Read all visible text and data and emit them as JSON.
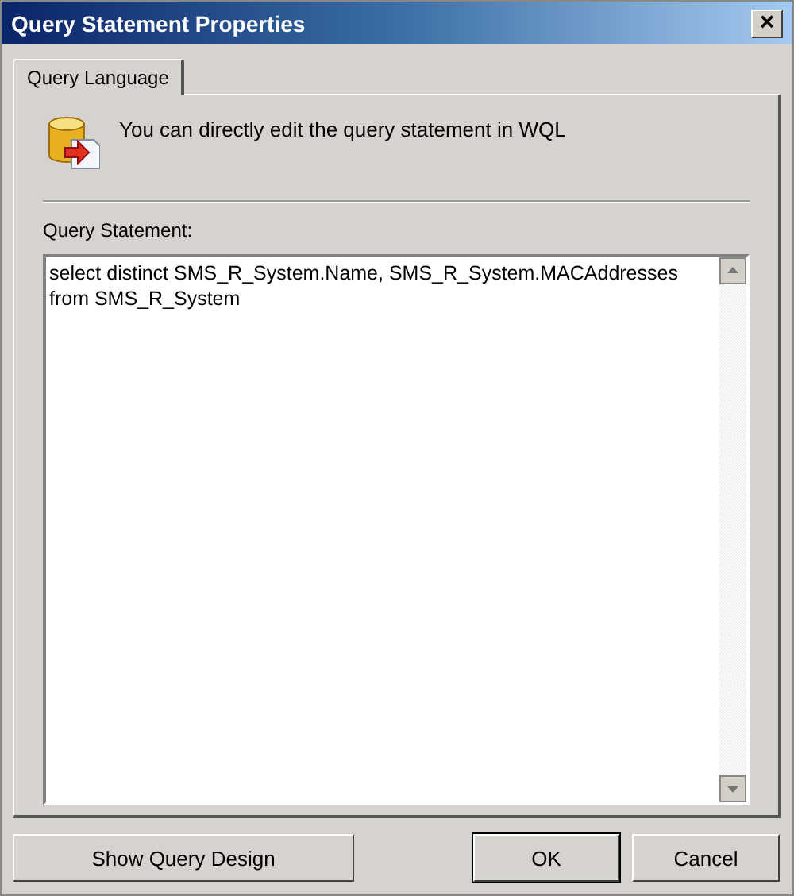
{
  "window": {
    "title": "Query Statement Properties",
    "close": "×"
  },
  "tabs": [
    {
      "label": "Query Language",
      "selected": true
    }
  ],
  "info": {
    "text": "You can directly edit the query statement in WQL"
  },
  "query": {
    "label": "Query Statement:",
    "lines": [
      "select distinct SMS_R_System.Name, SMS_R_System.MACAddresses",
      "from SMS_R_System"
    ]
  },
  "buttons": [
    {
      "label": "Show Query Design",
      "default": false
    },
    {
      "label": "OK",
      "default": true
    },
    {
      "label": "Cancel",
      "default": false
    }
  ]
}
